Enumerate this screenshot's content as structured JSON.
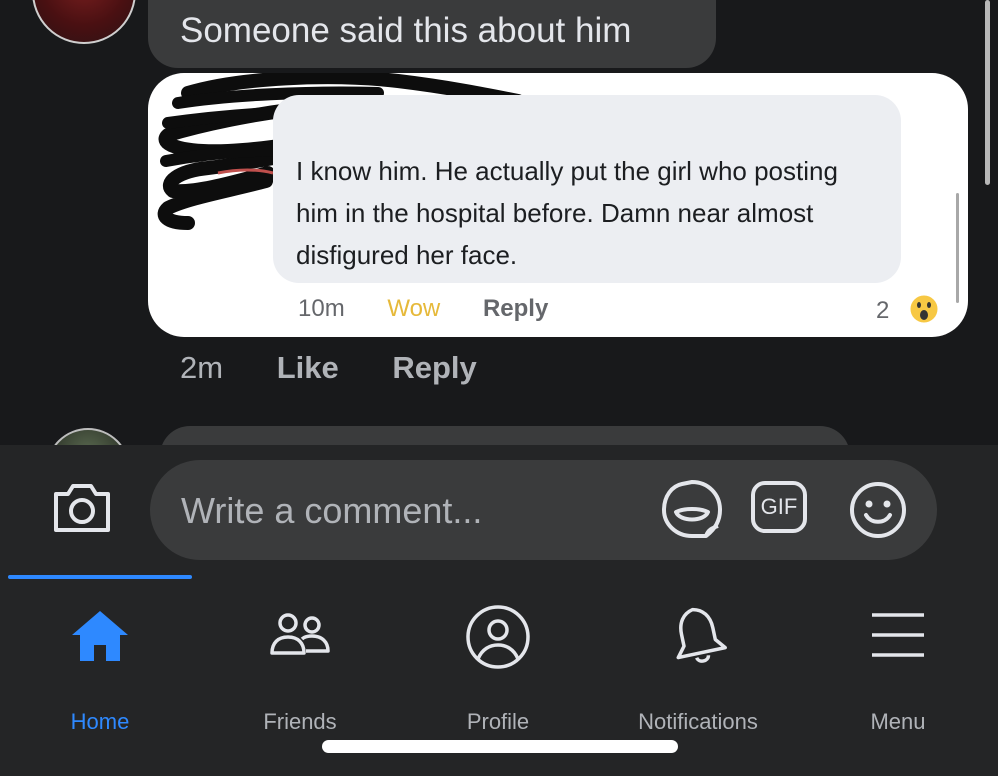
{
  "comment": {
    "text": "Someone said this about him",
    "time": "2m",
    "like_label": "Like",
    "reply_label": "Reply"
  },
  "embedded_screenshot": {
    "comment_text": "I know him. He actually put the girl who posting him in the hospital before. Damn near almost disfigured her face.",
    "time": "10m",
    "reaction_label": "Wow",
    "reply_label": "Reply",
    "reaction_count": "2"
  },
  "composer": {
    "placeholder": "Write a comment...",
    "gif_label": "GIF"
  },
  "nav": {
    "tabs": [
      {
        "label": "Home",
        "icon": "home-icon",
        "active": true
      },
      {
        "label": "Friends",
        "icon": "friends-icon"
      },
      {
        "label": "Profile",
        "icon": "profile-icon"
      },
      {
        "label": "Notifications",
        "icon": "bell-icon"
      },
      {
        "label": "Menu",
        "icon": "menu-icon"
      }
    ]
  },
  "colors": {
    "background": "#18191b",
    "bubble": "#3a3b3c",
    "bar": "#242526",
    "accent": "#2e89ff",
    "wow": "#e6b93a"
  }
}
